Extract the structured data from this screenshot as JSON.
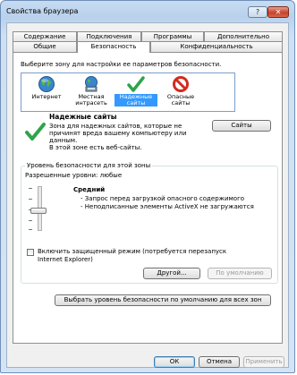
{
  "window": {
    "title": "Свойства браузера",
    "help": "?",
    "close": "✕"
  },
  "tabs_back": [
    "Содержание",
    "Подключения",
    "Программы",
    "Дополнительно"
  ],
  "tabs_front": [
    "Общие",
    "Безопасность",
    "Конфиденциальность"
  ],
  "active_tab": "Безопасность",
  "zones_prompt": "Выберите зону для настройки ее параметров безопасности.",
  "zones": [
    {
      "line1": "Интернет",
      "line2": "",
      "icon": "globe-icon"
    },
    {
      "line1": "Местная",
      "line2": "интрасеть",
      "icon": "intranet-icon"
    },
    {
      "line1": "Надежные",
      "line2": "сайты",
      "icon": "checkmark-icon",
      "selected": true
    },
    {
      "line1": "Опасные",
      "line2": "сайты",
      "icon": "restricted-icon"
    }
  ],
  "zone_info": {
    "title": "Надежные сайты",
    "desc1": "Зона для надежных сайтов, которые не",
    "desc2": "причинят вреда вашему компьютеру или",
    "desc3": "данным.",
    "desc4": "В этой зоне есть веб-сайты."
  },
  "sites_button": "Сайты",
  "security_level": {
    "group_title": "Уровень безопасности для этой зоны",
    "allowed": "Разрешенные уровни: любые",
    "level_name": "Средний",
    "desc1": "- Запрос перед загрузкой опасного содержимого",
    "desc2": "- Неподписанные элементы ActiveX не загружаются",
    "protected_mode_line1": "Включить защищенный режим (потребуется перезапуск",
    "protected_mode_line2": "Internet Explorer)",
    "custom_button": "Другой...",
    "default_button": "По умолчанию"
  },
  "reset_all_button": "Выбрать уровень безопасности по умолчанию для всех зон",
  "footer": {
    "ok": "ОК",
    "cancel": "Отмена",
    "apply": "Применить"
  }
}
